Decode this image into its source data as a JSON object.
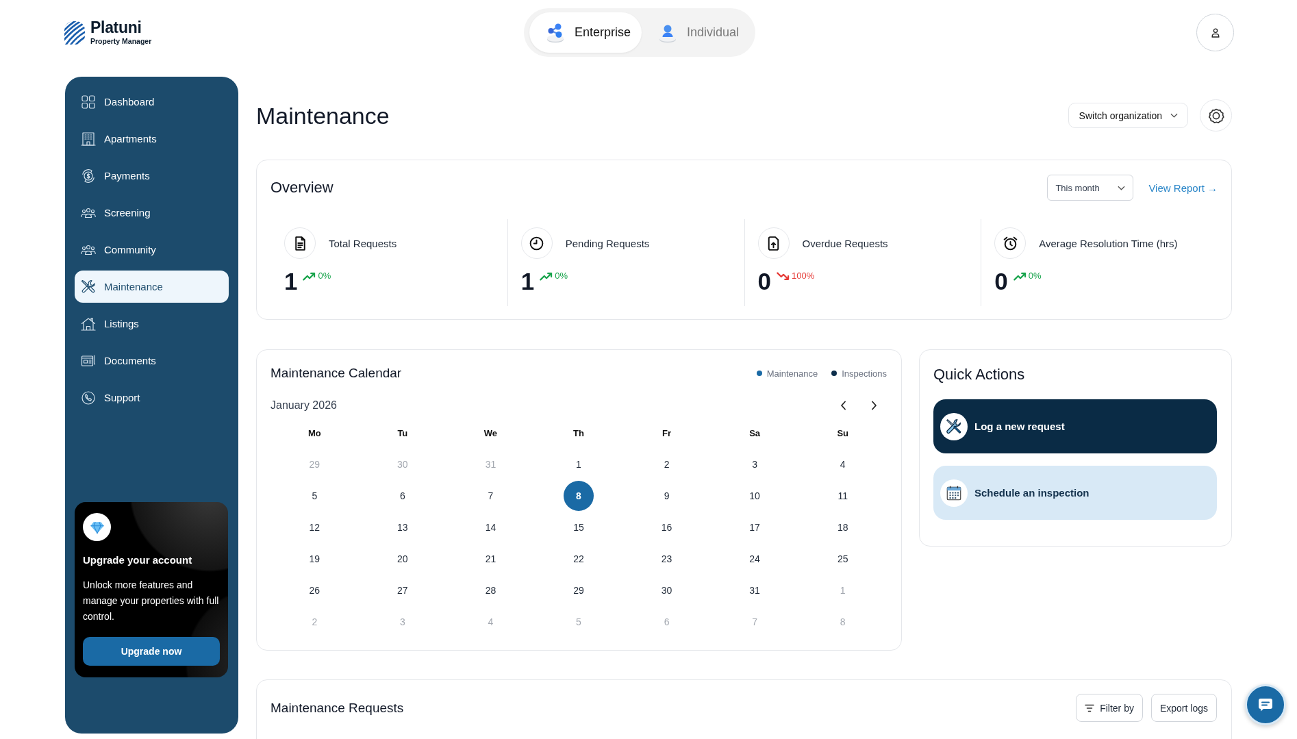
{
  "logo": {
    "name": "Platuni",
    "tagline": "Property Manager"
  },
  "mode_tabs": [
    {
      "label": "Enterprise",
      "selected": true
    },
    {
      "label": "Individual",
      "selected": false
    }
  ],
  "sidebar": {
    "items": [
      {
        "label": "Dashboard",
        "selected": false
      },
      {
        "label": "Apartments",
        "selected": false
      },
      {
        "label": "Payments",
        "selected": false
      },
      {
        "label": "Screening",
        "selected": false
      },
      {
        "label": "Community",
        "selected": false
      },
      {
        "label": "Maintenance",
        "selected": true
      },
      {
        "label": "Listings",
        "selected": false
      },
      {
        "label": "Documents",
        "selected": false
      },
      {
        "label": "Support",
        "selected": false
      }
    ],
    "upgrade_card": {
      "title": "Upgrade your account",
      "text": "Unlock more features and manage your properties with full control.",
      "button": "Upgrade now"
    }
  },
  "page": {
    "title": "Maintenance",
    "switch_organization": "Switch organization"
  },
  "overview": {
    "title": "Overview",
    "period": "This month",
    "link": "View Report →",
    "stats": [
      {
        "label": "Total Requests",
        "value": "1",
        "change": "0%",
        "falling": false
      },
      {
        "label": "Pending Requests",
        "value": "1",
        "change": "0%",
        "falling": false
      },
      {
        "label": "Overdue Requests",
        "value": "0",
        "change": "100%",
        "falling": true
      },
      {
        "label": "Average Resolution Time (hrs)",
        "value": "0",
        "change": "0%",
        "falling": false
      }
    ]
  },
  "calendar": {
    "title": "Maintenance Calendar",
    "legend": [
      {
        "label": "Maintenance",
        "color": "#1a6aa5"
      },
      {
        "label": "Inspections",
        "color": "#0d2e4b"
      }
    ],
    "month": "January 2026",
    "weekdays": [
      "Mo",
      "Tu",
      "We",
      "Th",
      "Fr",
      "Sa",
      "Su"
    ],
    "days": [
      {
        "label": "29",
        "outside": true,
        "selected": false
      },
      {
        "label": "30",
        "outside": true,
        "selected": false
      },
      {
        "label": "31",
        "outside": true,
        "selected": false
      },
      {
        "label": "1",
        "outside": false,
        "selected": false
      },
      {
        "label": "2",
        "outside": false,
        "selected": false
      },
      {
        "label": "3",
        "outside": false,
        "selected": false
      },
      {
        "label": "4",
        "outside": false,
        "selected": false
      },
      {
        "label": "5",
        "outside": false,
        "selected": false
      },
      {
        "label": "6",
        "outside": false,
        "selected": false
      },
      {
        "label": "7",
        "outside": false,
        "selected": false
      },
      {
        "label": "8",
        "outside": false,
        "selected": true
      },
      {
        "label": "9",
        "outside": false,
        "selected": false
      },
      {
        "label": "10",
        "outside": false,
        "selected": false
      },
      {
        "label": "11",
        "outside": false,
        "selected": false
      },
      {
        "label": "12",
        "outside": false,
        "selected": false
      },
      {
        "label": "13",
        "outside": false,
        "selected": false
      },
      {
        "label": "14",
        "outside": false,
        "selected": false
      },
      {
        "label": "15",
        "outside": false,
        "selected": false
      },
      {
        "label": "16",
        "outside": false,
        "selected": false
      },
      {
        "label": "17",
        "outside": false,
        "selected": false
      },
      {
        "label": "18",
        "outside": false,
        "selected": false
      },
      {
        "label": "19",
        "outside": false,
        "selected": false
      },
      {
        "label": "20",
        "outside": false,
        "selected": false
      },
      {
        "label": "21",
        "outside": false,
        "selected": false
      },
      {
        "label": "22",
        "outside": false,
        "selected": false
      },
      {
        "label": "23",
        "outside": false,
        "selected": false
      },
      {
        "label": "24",
        "outside": false,
        "selected": false
      },
      {
        "label": "25",
        "outside": false,
        "selected": false
      },
      {
        "label": "26",
        "outside": false,
        "selected": false
      },
      {
        "label": "27",
        "outside": false,
        "selected": false
      },
      {
        "label": "28",
        "outside": false,
        "selected": false
      },
      {
        "label": "29",
        "outside": false,
        "selected": false
      },
      {
        "label": "30",
        "outside": false,
        "selected": false
      },
      {
        "label": "31",
        "outside": false,
        "selected": false
      },
      {
        "label": "1",
        "outside": true,
        "selected": false
      },
      {
        "label": "2",
        "outside": true,
        "selected": false
      },
      {
        "label": "3",
        "outside": true,
        "selected": false
      },
      {
        "label": "4",
        "outside": true,
        "selected": false
      },
      {
        "label": "5",
        "outside": true,
        "selected": false
      },
      {
        "label": "6",
        "outside": true,
        "selected": false
      },
      {
        "label": "7",
        "outside": true,
        "selected": false
      },
      {
        "label": "8",
        "outside": true,
        "selected": false
      }
    ]
  },
  "quick_actions": {
    "title": "Quick Actions",
    "actions": [
      {
        "label": "Log a new request",
        "kind": "primary"
      },
      {
        "label": "Schedule an inspection",
        "kind": "secondary"
      }
    ]
  },
  "requests": {
    "title": "Maintenance Requests",
    "buttons": [
      {
        "label": "Filter by",
        "kind": "filter"
      },
      {
        "label": "Export logs",
        "kind": "plain"
      }
    ]
  }
}
